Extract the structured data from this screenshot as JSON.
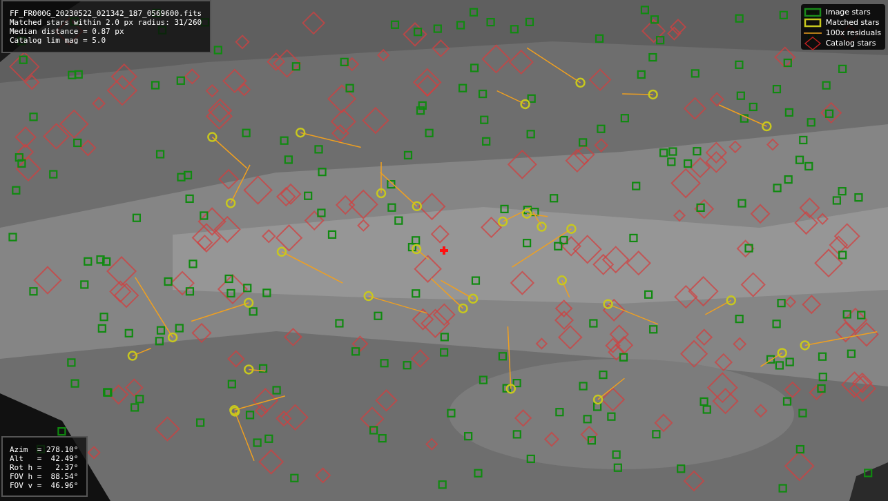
{
  "info_box": {
    "lines": [
      "FF_FR000G_20230522_021342_187_0569600.fits",
      "Matched stars within 2.0 px radius: 31/260",
      "Median distance = 0.87 px",
      "Catalog lim mag = 5.0"
    ]
  },
  "legend": {
    "items": [
      {
        "label": "Image stars"
      },
      {
        "kind": "matched",
        "label": "Matched stars"
      },
      {
        "kind": "residual",
        "label": "100x residuals"
      },
      {
        "kind": "catalog",
        "label": "Catalog stars"
      }
    ]
  },
  "pointing_box": {
    "lines": [
      "Azim  = 278.10°",
      "Alt   =  42.49°",
      "Rot h =   2.37°",
      "FOV h =  88.54°",
      "FOV v =  46.96°"
    ]
  }
}
